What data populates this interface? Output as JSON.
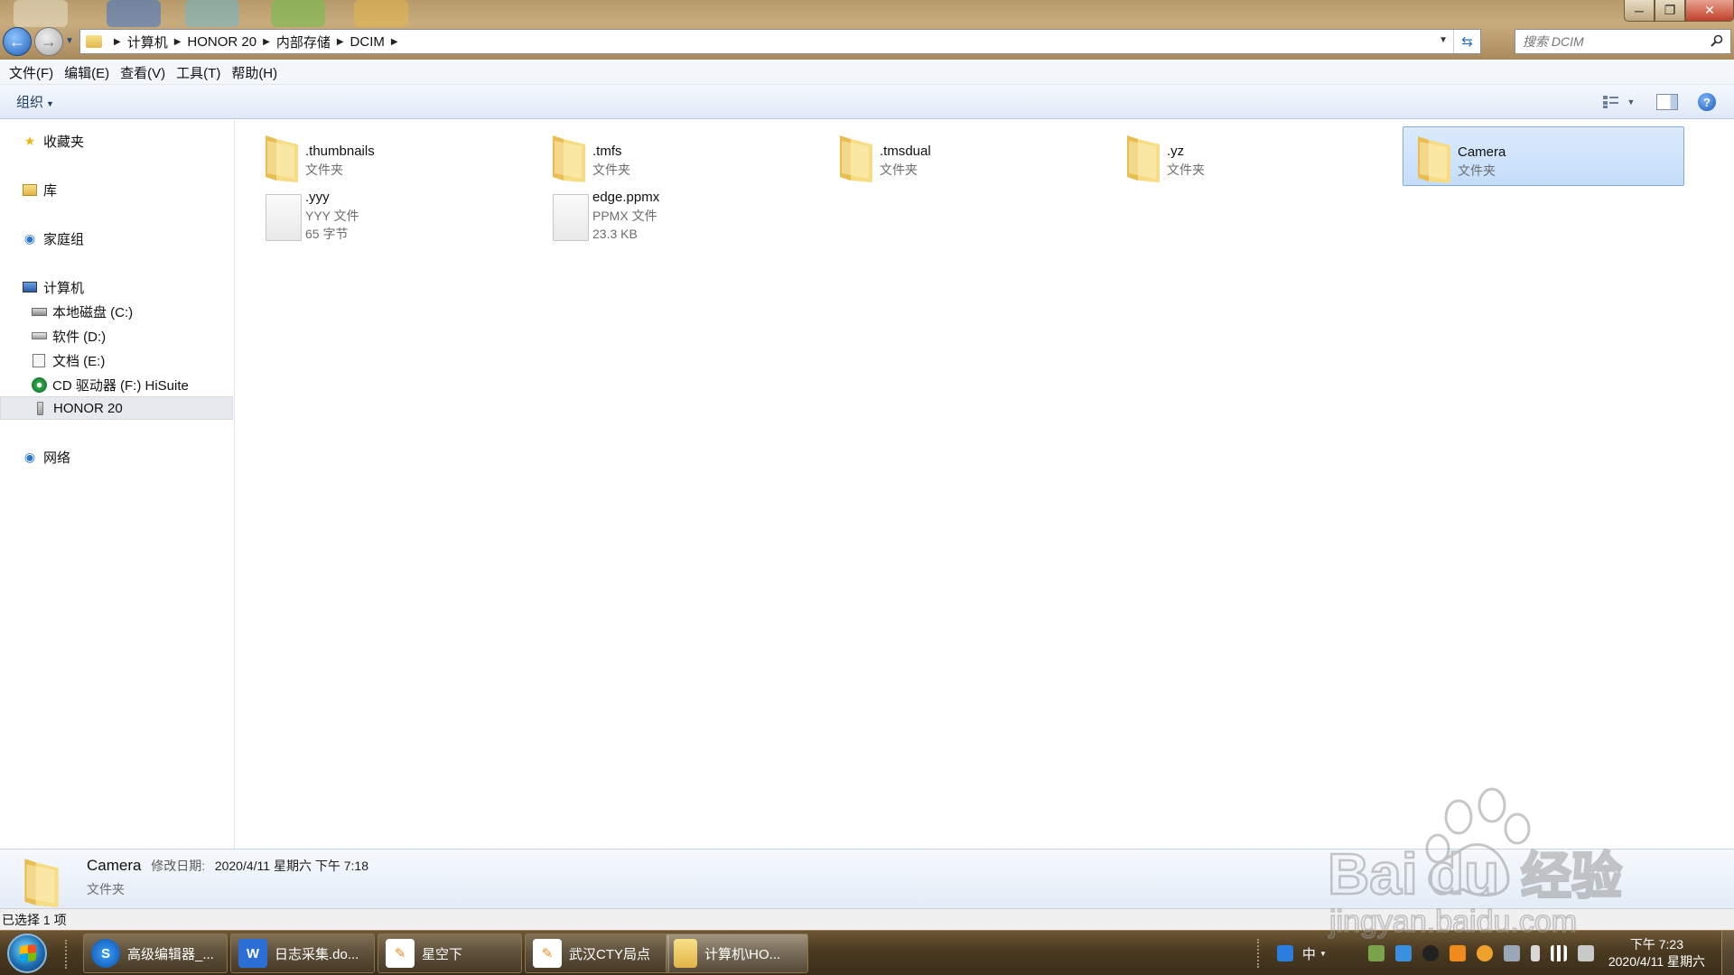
{
  "address": {
    "crumbs": [
      "计算机",
      "HONOR 20",
      "内部存储",
      "DCIM"
    ]
  },
  "search": {
    "placeholder": "搜索 DCIM"
  },
  "menu": [
    "文件(F)",
    "编辑(E)",
    "查看(V)",
    "工具(T)",
    "帮助(H)"
  ],
  "toolbar": {
    "organize_label": "组织"
  },
  "nav": {
    "favorites": "收藏夹",
    "libraries": "库",
    "homegroup": "家庭组",
    "computer": "计算机",
    "drives": [
      "本地磁盘 (C:)",
      "软件 (D:)",
      "文档 (E:)",
      "CD 驱动器 (F:) HiSuite",
      "HONOR 20"
    ],
    "network": "网络"
  },
  "files": [
    {
      "name": ".thumbnails",
      "type": "文件夹"
    },
    {
      "name": ".tmfs",
      "type": "文件夹"
    },
    {
      "name": ".tmsdual",
      "type": "文件夹"
    },
    {
      "name": ".yz",
      "type": "文件夹"
    },
    {
      "name": "Camera",
      "type": "文件夹"
    },
    {
      "name": ".yyy",
      "type": "YYY 文件",
      "size": "65 字节"
    },
    {
      "name": "edge.ppmx",
      "type": "PPMX 文件",
      "size": "23.3 KB"
    }
  ],
  "details": {
    "name": "Camera",
    "modified_label": "修改日期:",
    "modified_value": "2020/4/11 星期六 下午 7:18",
    "type": "文件夹"
  },
  "status": {
    "selection": "已选择 1 项"
  },
  "taskbar": {
    "tasks": [
      "高级编辑器_...",
      "日志采集.do...",
      "星空下",
      "武汉CTY局点",
      "计算机\\HO..."
    ],
    "ime": "中",
    "time": "下午 7:23",
    "date": "2020/4/11 星期六"
  },
  "colors": {
    "selection_bg": "#cce2fb",
    "selection_border": "#84acdd",
    "taskbar": "#4b3b22",
    "folder": "#f2cf6a"
  }
}
